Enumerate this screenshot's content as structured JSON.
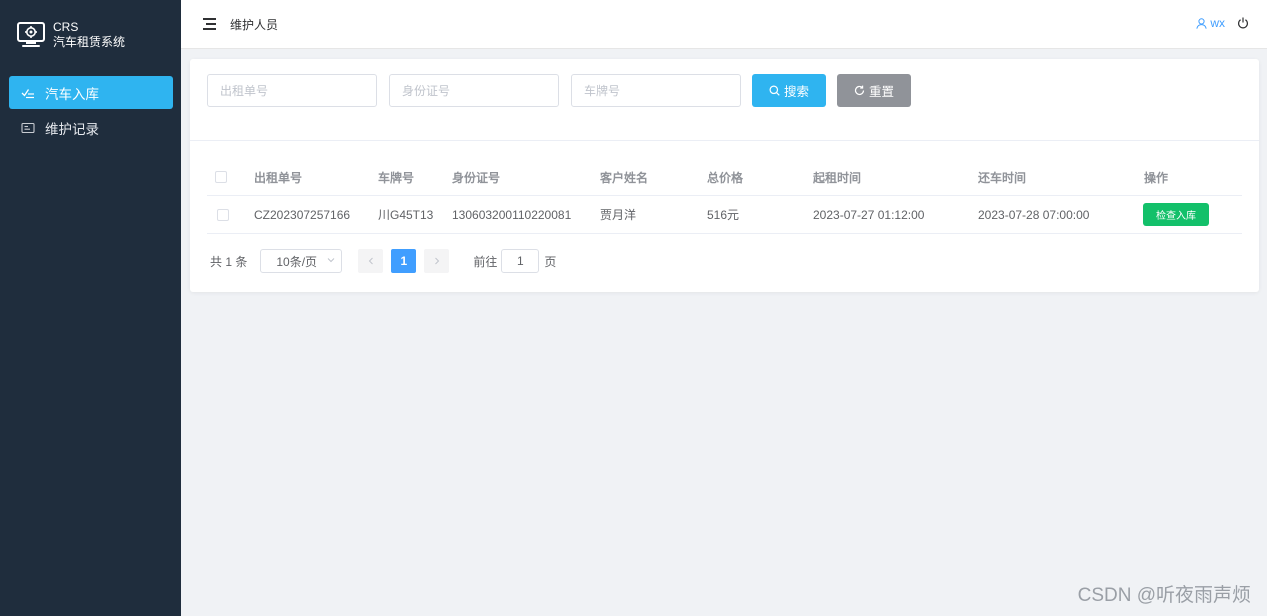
{
  "brand": {
    "title": "CRS",
    "subtitle": "汽车租赁系统"
  },
  "sidebar": {
    "items": [
      {
        "label": "汽车入库",
        "icon": "check-list-icon",
        "active": true
      },
      {
        "label": "维护记录",
        "icon": "card-icon",
        "active": false
      }
    ]
  },
  "header": {
    "title": "维护人员",
    "user": "wx"
  },
  "search": {
    "order_placeholder": "出租单号",
    "id_placeholder": "身份证号",
    "plate_placeholder": "车牌号",
    "search_label": "搜索",
    "reset_label": "重置"
  },
  "table": {
    "columns": [
      "出租单号",
      "车牌号",
      "身份证号",
      "客户姓名",
      "总价格",
      "起租时间",
      "还车时间",
      "操作"
    ],
    "rows": [
      {
        "order_no": "CZ202307257166",
        "plate": "川G45T13",
        "id_no": "130603200110220081",
        "name": "贾月洋",
        "price": "516元",
        "start": "2023-07-27 01:12:00",
        "end": "2023-07-28 07:00:00",
        "action": "检查入库"
      }
    ]
  },
  "pagination": {
    "total": "共 1 条",
    "page_size": "10条/页",
    "current_page": "1",
    "jump_prefix": "前往",
    "jump_value": "1",
    "jump_suffix": "页"
  },
  "watermark": "CSDN @听夜雨声烦",
  "colors": {
    "sidebar": "#1f2d3d",
    "accent": "#2fb4f0",
    "success": "#13c06a",
    "link": "#409eff"
  }
}
